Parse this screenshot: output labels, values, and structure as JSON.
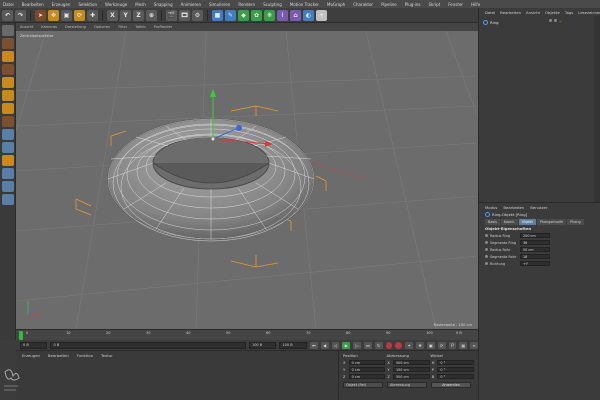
{
  "menubar": [
    "Datei",
    "Bearbeiten",
    "Erzeugen",
    "Selektion",
    "Werkzeuge",
    "Mesh",
    "Snapping",
    "Animieren",
    "Simulieren",
    "Rendern",
    "Sculpting",
    "Motion Tracker",
    "MoGraph",
    "Charakter",
    "Pipeline",
    "Plug-ins",
    "Skript",
    "Fenster",
    "Hilfe"
  ],
  "toolbar": {
    "axis_x": "X",
    "axis_y": "Y",
    "axis_z": "Z"
  },
  "viewport": {
    "menu": [
      "Ansicht",
      "Kameras",
      "Darstellung",
      "Optionen",
      "Filter",
      "Tafeln",
      "ProRender"
    ],
    "label": "Zentralperspektive",
    "status": "Rasterweite : 100 cm"
  },
  "timeline": {
    "ticks": [
      "0",
      "10",
      "20",
      "30",
      "40",
      "50",
      "60",
      "70",
      "80",
      "90",
      "100"
    ],
    "end_label": "0 B"
  },
  "transport": {
    "start": "0 B",
    "current": "0 B",
    "end": "100 B",
    "end2": "100 B"
  },
  "material_manager": {
    "menu": [
      "Erzeugen",
      "Bearbeiten",
      "Funktion",
      "Textur"
    ]
  },
  "coordinates": {
    "headers": [
      "Position",
      "Abmessung",
      "Winkel"
    ],
    "rows": [
      {
        "axis": "X",
        "pos": "0 cm",
        "size_axis": "X",
        "size": "500 cm",
        "rot_axis": "H",
        "rot": "0 °"
      },
      {
        "axis": "Y",
        "pos": "0 cm",
        "size_axis": "Y",
        "size": "150 cm",
        "rot_axis": "P",
        "rot": "0 °"
      },
      {
        "axis": "Z",
        "pos": "0 cm",
        "size_axis": "Z",
        "size": "500 cm",
        "rot_axis": "B",
        "rot": "0 °"
      }
    ],
    "mode": "Objekt (Rel)",
    "size_mode": "Abmessung",
    "apply": "Anwenden"
  },
  "object_manager": {
    "menu": [
      "Datei",
      "Bearbeiten",
      "Ansicht",
      "Objekte",
      "Tags",
      "Lesezeichen"
    ],
    "objects": [
      {
        "name": "Ring"
      }
    ]
  },
  "attribute_manager": {
    "menu": [
      "Modus",
      "Bearbeiten",
      "Benutzer"
    ],
    "object_title": "Ring-Objekt [Ring]",
    "tabs": [
      "Basis",
      "Koord.",
      "Objekt",
      "Phongsmooth",
      "Phong"
    ],
    "active_tab": "Objekt",
    "section": "Objekt-Eigenschaften",
    "props": [
      {
        "label": "Radius Ring",
        "value": "200 cm"
      },
      {
        "label": "Segmente Ring",
        "value": "36"
      },
      {
        "label": "Radius Rohr",
        "value": "50 cm"
      },
      {
        "label": "Segmente Rohr",
        "value": "18"
      },
      {
        "label": "Richtung",
        "value": "+Y"
      }
    ]
  },
  "colors": {
    "viewport_bg": "#6c6c6c",
    "mesh_fill": "#8f8f8f",
    "wire": "#e8e8e8",
    "bbox": "#e89a2a",
    "accent_blue": "#4aa0e6"
  }
}
